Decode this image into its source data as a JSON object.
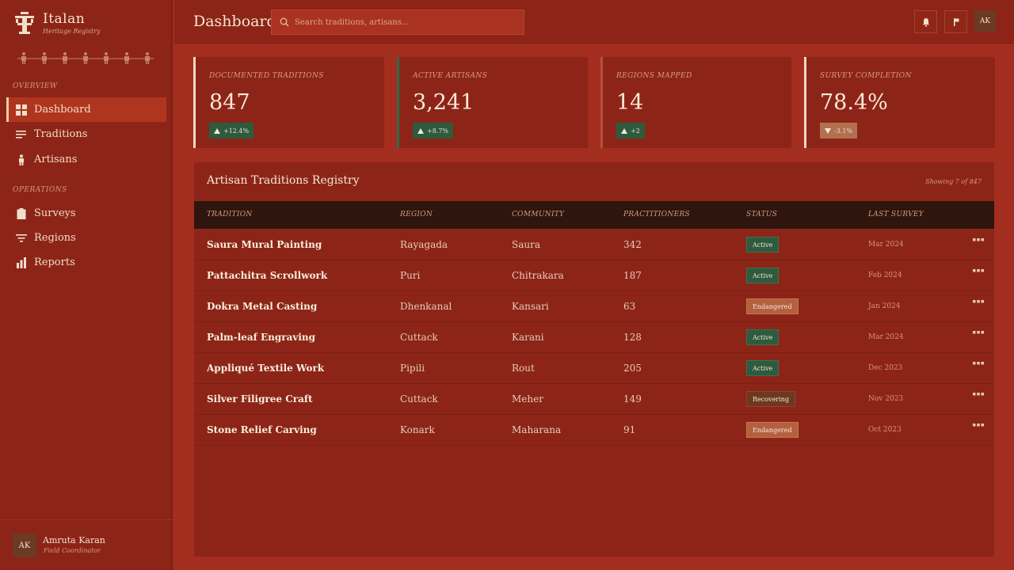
{
  "brand": {
    "name": "Italan",
    "subtitle": "Heritage Registry"
  },
  "sidebar": {
    "sections": [
      {
        "label": "Overview",
        "items": [
          {
            "label": "Dashboard",
            "icon": "grid-icon",
            "active": true
          },
          {
            "label": "Traditions",
            "icon": "list-icon",
            "active": false
          },
          {
            "label": "Artisans",
            "icon": "person-icon",
            "active": false
          }
        ]
      },
      {
        "label": "Operations",
        "items": [
          {
            "label": "Surveys",
            "icon": "clipboard-icon",
            "active": false
          },
          {
            "label": "Regions",
            "icon": "filter-icon",
            "active": false
          },
          {
            "label": "Reports",
            "icon": "bar-chart-icon",
            "active": false
          }
        ]
      }
    ]
  },
  "user": {
    "initials": "AK",
    "name": "Amruta Karan",
    "role": "Field Coordinator"
  },
  "header": {
    "title": "Dashboard",
    "search_placeholder": "Search traditions, artisans...",
    "avatar_initials": "AK"
  },
  "kpis": [
    {
      "label": "Documented Traditions",
      "value": "847",
      "change": "+12.4%",
      "direction": "up",
      "accent": "#efd9c2"
    },
    {
      "label": "Active Artisans",
      "value": "3,241",
      "change": "+8.7%",
      "direction": "up",
      "accent": "#2e6a4b"
    },
    {
      "label": "Regions Mapped",
      "value": "14",
      "change": "+2",
      "direction": "up",
      "accent": "#b4513a"
    },
    {
      "label": "Survey Completion",
      "value": "78.4%",
      "change": "-3.1%",
      "direction": "down",
      "accent": "#efd9c2"
    }
  ],
  "table": {
    "title": "Artisan Traditions Registry",
    "meta": "Showing 7 of 847",
    "columns": [
      "Tradition",
      "Region",
      "Community",
      "Practitioners",
      "Status",
      "Last Survey"
    ],
    "rows": [
      {
        "tradition": "Saura Mural Painting",
        "region": "Rayagada",
        "community": "Saura",
        "practitioners": "342",
        "status": "Active",
        "last_survey": "Mar 2024"
      },
      {
        "tradition": "Pattachitra Scrollwork",
        "region": "Puri",
        "community": "Chitrakara",
        "practitioners": "187",
        "status": "Active",
        "last_survey": "Feb 2024"
      },
      {
        "tradition": "Dokra Metal Casting",
        "region": "Dhenkanal",
        "community": "Kansari",
        "practitioners": "63",
        "status": "Endangered",
        "last_survey": "Jan 2024"
      },
      {
        "tradition": "Palm-leaf Engraving",
        "region": "Cuttack",
        "community": "Karani",
        "practitioners": "128",
        "status": "Active",
        "last_survey": "Mar 2024"
      },
      {
        "tradition": "Appliqué Textile Work",
        "region": "Pipili",
        "community": "Rout",
        "practitioners": "205",
        "status": "Active",
        "last_survey": "Dec 2023"
      },
      {
        "tradition": "Silver Filigree Craft",
        "region": "Cuttack",
        "community": "Meher",
        "practitioners": "149",
        "status": "Recovering",
        "last_survey": "Nov 2023"
      },
      {
        "tradition": "Stone Relief Carving",
        "region": "Konark",
        "community": "Maharana",
        "practitioners": "91",
        "status": "Endangered",
        "last_survey": "Oct 2023"
      }
    ]
  },
  "colors": {
    "background": "#a32d1f",
    "panel": "#8c2518",
    "status_active": "#2e5a3e",
    "status_endangered": "#b4603f",
    "status_recovering": "#6d3820"
  }
}
